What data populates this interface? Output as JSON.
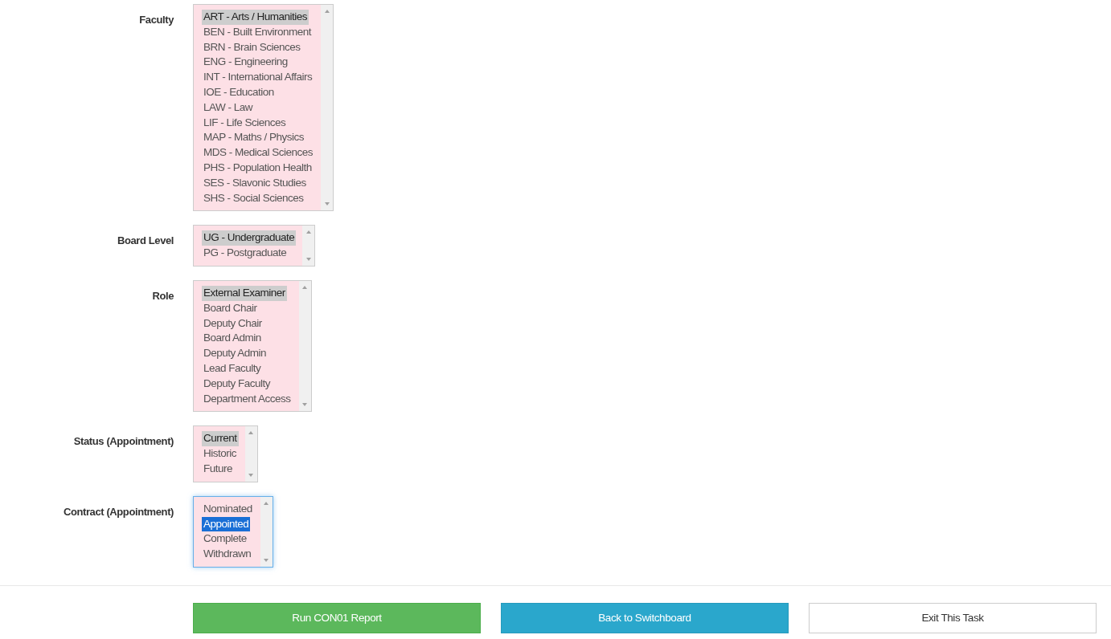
{
  "fields": [
    {
      "label": "Faculty",
      "focused": false,
      "options": [
        {
          "text": "ART - Arts / Humanities",
          "selected": true
        },
        {
          "text": "BEN - Built Environment",
          "selected": false
        },
        {
          "text": "BRN - Brain Sciences",
          "selected": false
        },
        {
          "text": "ENG - Engineering",
          "selected": false
        },
        {
          "text": "INT - International Affairs",
          "selected": false
        },
        {
          "text": "IOE - Education",
          "selected": false
        },
        {
          "text": "LAW - Law",
          "selected": false
        },
        {
          "text": "LIF - Life Sciences",
          "selected": false
        },
        {
          "text": "MAP - Maths / Physics",
          "selected": false
        },
        {
          "text": "MDS - Medical Sciences",
          "selected": false
        },
        {
          "text": "PHS - Population Health",
          "selected": false
        },
        {
          "text": "SES - Slavonic Studies",
          "selected": false
        },
        {
          "text": "SHS - Social Sciences",
          "selected": false
        }
      ]
    },
    {
      "label": "Board Level",
      "focused": false,
      "options": [
        {
          "text": "UG - Undergraduate",
          "selected": true
        },
        {
          "text": "PG - Postgraduate",
          "selected": false
        }
      ]
    },
    {
      "label": "Role",
      "focused": false,
      "options": [
        {
          "text": "External Examiner",
          "selected": true
        },
        {
          "text": "Board Chair",
          "selected": false
        },
        {
          "text": "Deputy Chair",
          "selected": false
        },
        {
          "text": "Board Admin",
          "selected": false
        },
        {
          "text": "Deputy Admin",
          "selected": false
        },
        {
          "text": "Lead Faculty",
          "selected": false
        },
        {
          "text": "Deputy Faculty",
          "selected": false
        },
        {
          "text": "Department Access",
          "selected": false
        }
      ]
    },
    {
      "label": "Status (Appointment)",
      "focused": false,
      "options": [
        {
          "text": "Current",
          "selected": true
        },
        {
          "text": "Historic",
          "selected": false
        },
        {
          "text": "Future",
          "selected": false
        }
      ]
    },
    {
      "label": "Contract (Appointment)",
      "focused": true,
      "options": [
        {
          "text": "Nominated",
          "selected": false
        },
        {
          "text": "Appointed",
          "selected": true
        },
        {
          "text": "Complete",
          "selected": false
        },
        {
          "text": "Withdrawn",
          "selected": false
        }
      ]
    }
  ],
  "buttons": [
    {
      "label": "Run CON01 Report",
      "kind": "success"
    },
    {
      "label": "Back to Switchboard",
      "kind": "info"
    },
    {
      "label": "Exit This Task",
      "kind": "plain"
    }
  ]
}
